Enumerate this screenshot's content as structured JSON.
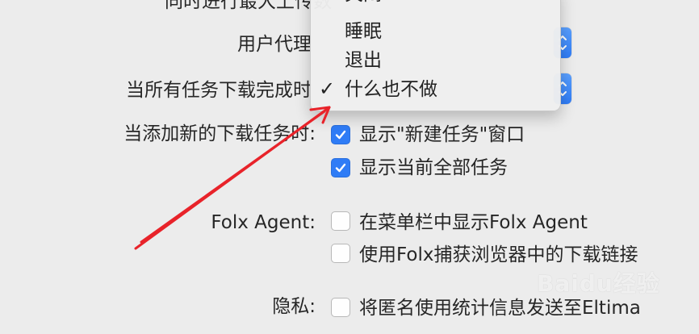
{
  "prefs": {
    "top_truncated_label": "同时进行最大上传数",
    "user_agent_label": "用户代理",
    "on_all_done_label": "当所有任务下载完成时",
    "on_new_task_label": "当添加新的下载任务时:",
    "folx_agent_label": "Folx Agent:",
    "privacy_label": "隐私:"
  },
  "menu": {
    "items": [
      "关闭",
      "睡眠",
      "退出",
      "什么也不做"
    ],
    "selected": "什么也不做",
    "check_glyph": "✓"
  },
  "checkboxes": {
    "show_new_task_window": {
      "label": "显示\"新建任务\"窗口",
      "checked": true
    },
    "show_all_tasks": {
      "label": "显示当前全部任务",
      "checked": true
    },
    "show_in_menubar": {
      "label": "在菜单栏中显示Folx Agent",
      "checked": false
    },
    "capture_browser": {
      "label": "使用Folx捕获浏览器中的下载链接",
      "checked": false
    },
    "send_stats": {
      "label": "将匿名使用统计信息发送至Eltima",
      "checked": false
    }
  },
  "watermark": {
    "text": "Baidu经验"
  },
  "colors": {
    "accent": "#2f7cf6",
    "arrow": "#e8232a",
    "window_bg": "#ececec"
  }
}
